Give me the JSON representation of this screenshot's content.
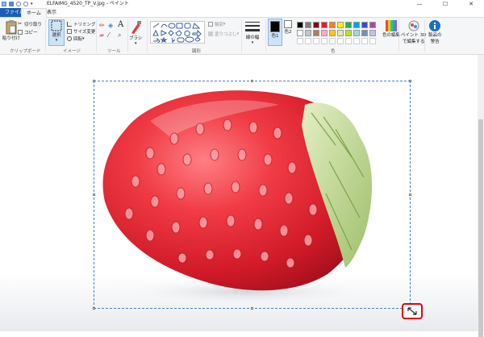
{
  "window": {
    "title": "ELFAIMG_4520_TP_V.jpg - ペイント",
    "minimize": "—",
    "maximize": "☐",
    "close": "✕"
  },
  "tabs": {
    "file": "ファイル",
    "home": "ホーム",
    "view": "表示"
  },
  "clipboard": {
    "paste": "貼り付け",
    "cut": "切り取り",
    "copy": "コピー",
    "group": "クリップボード"
  },
  "image": {
    "select": "選択",
    "crop": "トリミング",
    "resize": "サイズ変更",
    "rotate": "回転",
    "group": "イメージ"
  },
  "tools": {
    "group": "ツール",
    "text_tool": "A"
  },
  "brush": {
    "label": "ブラシ"
  },
  "shapes": {
    "outline": "輪郭",
    "fill": "塗りつぶし",
    "group": "図形"
  },
  "size": {
    "label": "線の幅"
  },
  "color": {
    "color1": "色1",
    "color2": "色2",
    "edit": "色の編集",
    "group": "色",
    "swatches": [
      "#000000",
      "#7f7f7f",
      "#880015",
      "#ed1c24",
      "#ff7f27",
      "#fff200",
      "#22b14c",
      "#00a2e8",
      "#3f48cc",
      "#a349a4",
      "#ffffff",
      "#c3c3c3",
      "#b97a57",
      "#ffaec9",
      "#ffc90e",
      "#efe4b0",
      "#b5e61d",
      "#99d9ea",
      "#7092be",
      "#c8bfe7"
    ],
    "color1_value": "#000000",
    "color2_value": "#ffffff"
  },
  "paint3d": {
    "label1": "ペイント 3D",
    "label2": "で編集する"
  },
  "product": {
    "label1": "製品の",
    "label2": "警告"
  }
}
